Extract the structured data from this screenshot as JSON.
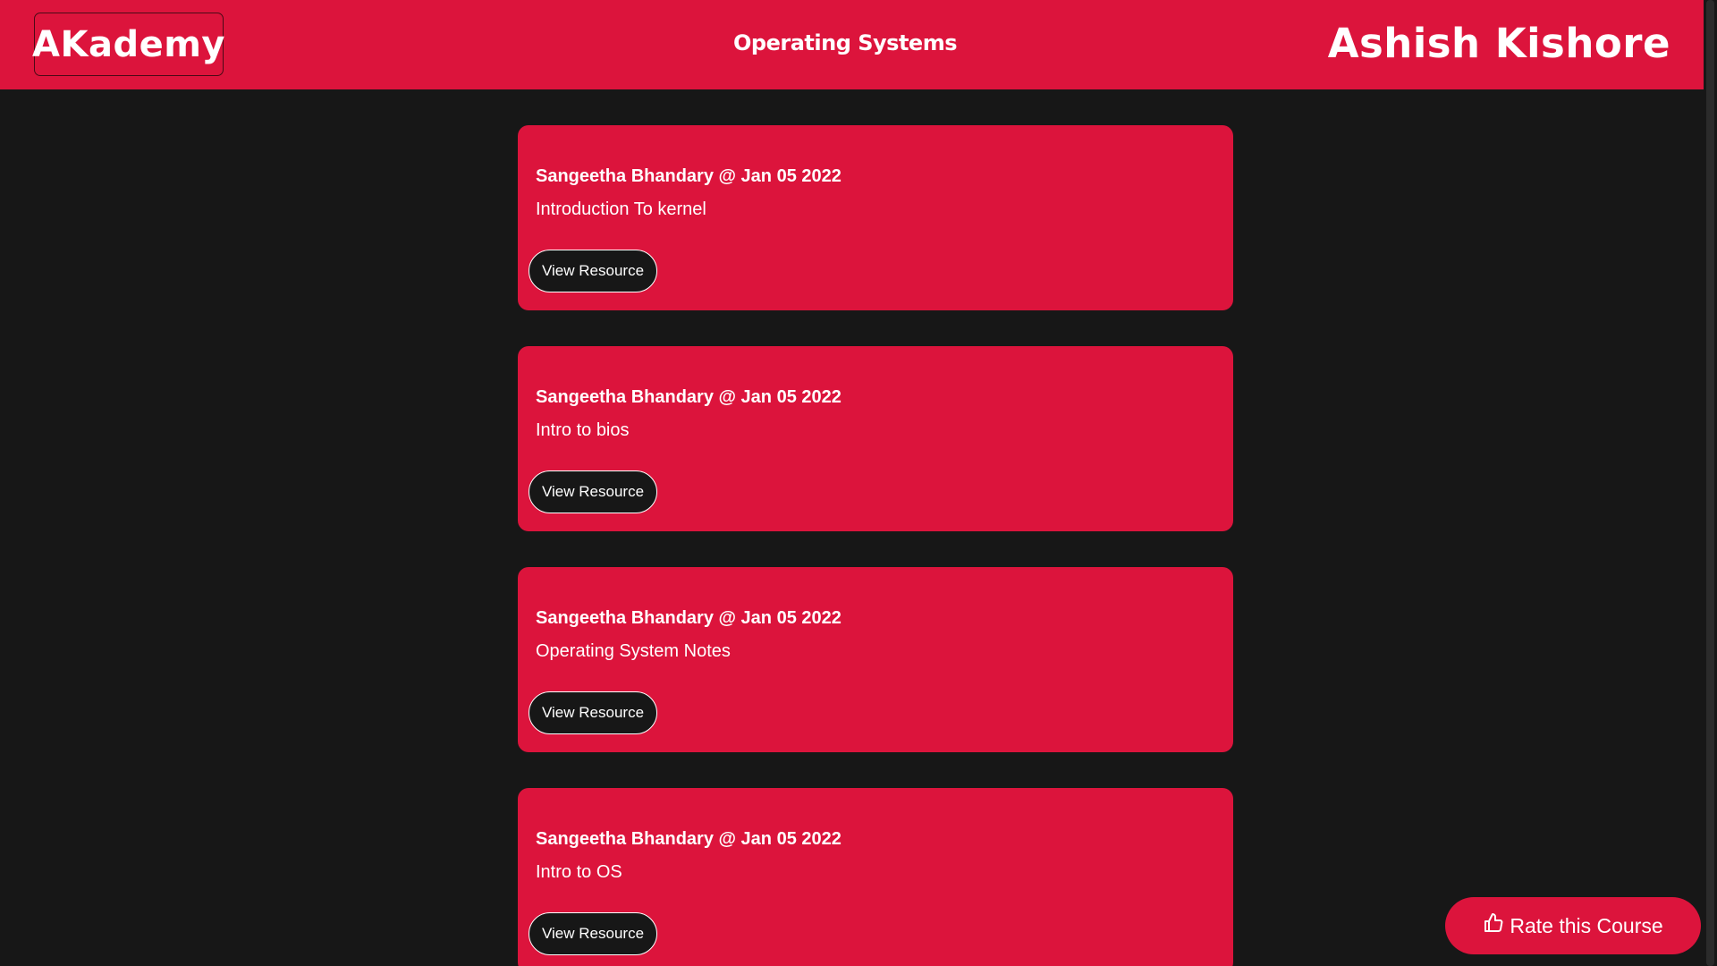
{
  "header": {
    "logo": "AKademy",
    "course_title": "Operating Systems",
    "user_name": "Ashish Kishore"
  },
  "resources": [
    {
      "meta": "Sangeetha Bhandary @ Jan 05 2022",
      "title": "Introduction To kernel",
      "button": "View Resource"
    },
    {
      "meta": "Sangeetha Bhandary @ Jan 05 2022",
      "title": "Intro to bios",
      "button": "View Resource"
    },
    {
      "meta": "Sangeetha Bhandary @ Jan 05 2022",
      "title": "Operating System Notes",
      "button": "View Resource"
    },
    {
      "meta": "Sangeetha Bhandary @ Jan 05 2022",
      "title": "Intro to OS",
      "button": "View Resource"
    }
  ],
  "rate_button": {
    "label": "Rate this Course",
    "icon": "thumbs-up-icon"
  },
  "colors": {
    "accent": "#dc143c",
    "background": "#171717",
    "text": "#ffffff"
  }
}
